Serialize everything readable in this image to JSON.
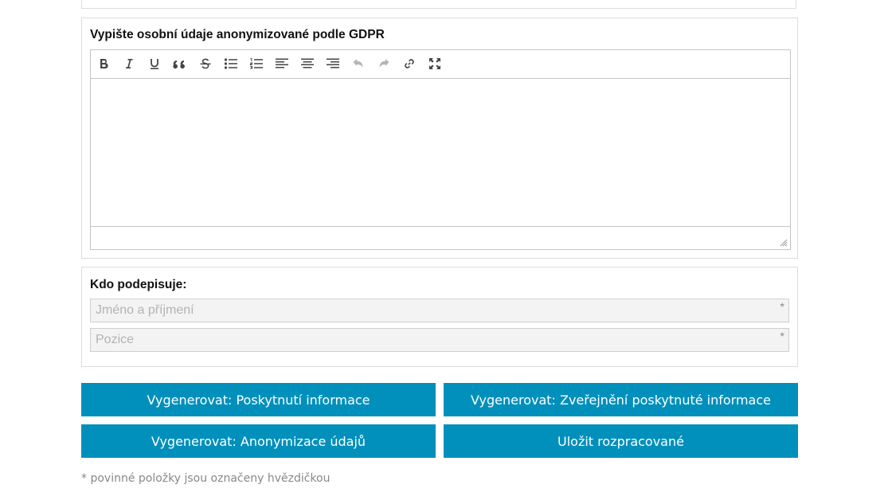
{
  "gdpr_panel": {
    "title": "Vypište osobní údaje anonymizované podle GDPR",
    "toolbar": [
      {
        "name": "bold",
        "icon": "bold-icon"
      },
      {
        "name": "italic",
        "icon": "italic-icon"
      },
      {
        "name": "underline",
        "icon": "underline-icon"
      },
      {
        "name": "blockquote",
        "icon": "quote-icon"
      },
      {
        "name": "strikethrough",
        "icon": "strikethrough-icon"
      },
      {
        "name": "bulleted-list",
        "icon": "bulleted-list-icon"
      },
      {
        "name": "numbered-list",
        "icon": "numbered-list-icon"
      },
      {
        "name": "align-left",
        "icon": "align-left-icon"
      },
      {
        "name": "align-center",
        "icon": "align-center-icon"
      },
      {
        "name": "align-right",
        "icon": "align-right-icon"
      },
      {
        "name": "undo",
        "icon": "undo-icon"
      },
      {
        "name": "redo",
        "icon": "redo-icon"
      },
      {
        "name": "link",
        "icon": "link-icon"
      },
      {
        "name": "fullscreen",
        "icon": "fullscreen-icon"
      }
    ],
    "content": ""
  },
  "signer_panel": {
    "title": "Kdo podepisuje:",
    "name_field": {
      "placeholder": "Jméno a příjmení",
      "value": "",
      "required_mark": "*"
    },
    "position_field": {
      "placeholder": "Pozice",
      "value": "",
      "required_mark": "*"
    }
  },
  "buttons": {
    "generate_provision": "Vygenerovat: Poskytnutí informace",
    "generate_publication": "Vygenerovat: Zveřejnění poskytnuté informace",
    "generate_anonymization": "Vygenerovat: Anonymizace údajů",
    "save_draft": "Uložit rozpracované"
  },
  "footnote": "* povinné položky jsou označeny hvězdičkou",
  "colors": {
    "button_bg": "#0090bb",
    "button_text": "#ffffff",
    "field_bg": "#f3f3f3",
    "border": "#dcdcdc",
    "disabled_icon": "#b5b5b5"
  }
}
